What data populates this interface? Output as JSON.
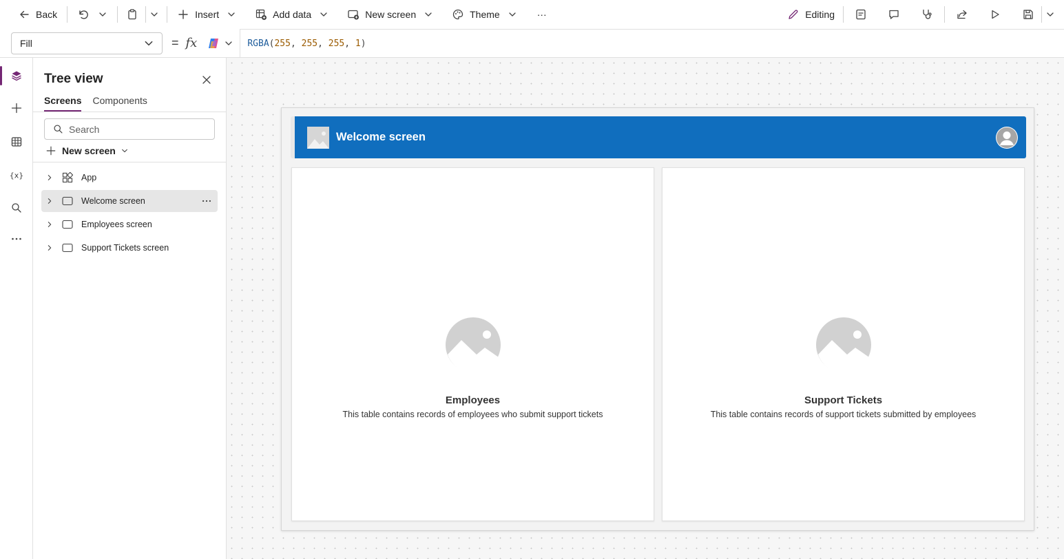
{
  "toolbar": {
    "back_label": "Back",
    "insert_label": "Insert",
    "add_data_label": "Add data",
    "new_screen_label": "New screen",
    "theme_label": "Theme",
    "more_label": "···",
    "editing_label": "Editing"
  },
  "formula_bar": {
    "property": "Fill",
    "equals": "=",
    "fx": "fx",
    "formula_fn": "RGBA",
    "formula_args": [
      "255",
      "255",
      "255",
      "1"
    ]
  },
  "rail": {
    "items": [
      "tree-view",
      "insert",
      "data",
      "variables",
      "search",
      "more"
    ]
  },
  "tree_view": {
    "title": "Tree view",
    "tabs": [
      {
        "label": "Screens",
        "active": true
      },
      {
        "label": "Components",
        "active": false
      }
    ],
    "search_placeholder": "Search",
    "new_screen_label": "New screen",
    "items": [
      {
        "label": "App",
        "icon": "app-icon",
        "selected": false
      },
      {
        "label": "Welcome screen",
        "icon": "screen-icon",
        "selected": true
      },
      {
        "label": "Employees screen",
        "icon": "screen-icon",
        "selected": false
      },
      {
        "label": "Support Tickets screen",
        "icon": "screen-icon",
        "selected": false
      }
    ]
  },
  "canvas": {
    "header_title": "Welcome screen",
    "header_color": "#106ebe",
    "cards": [
      {
        "title": "Employees",
        "description": "This table contains records of employees who submit support tickets"
      },
      {
        "title": "Support Tickets",
        "description": "This table contains records of support tickets submitted by employees"
      }
    ]
  },
  "colors": {
    "accent": "#742774",
    "header": "#106ebe"
  }
}
